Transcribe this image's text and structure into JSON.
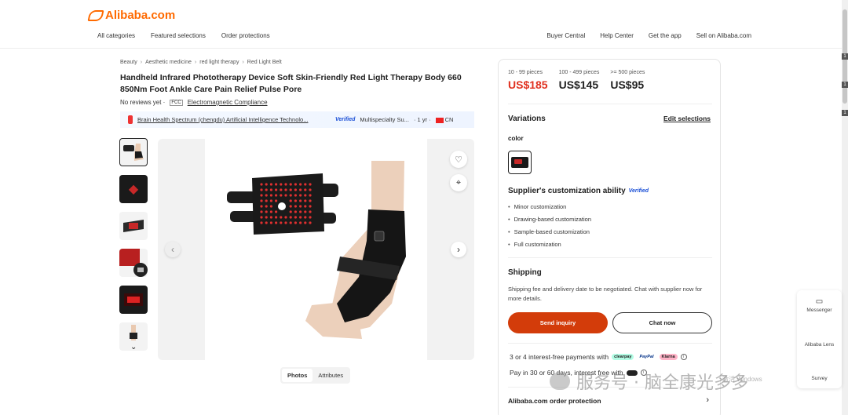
{
  "header": {
    "logo_text": "Alibaba.com",
    "nav_left": [
      "All categories",
      "Featured selections",
      "Order protections"
    ],
    "nav_right": [
      "Buyer Central",
      "Help Center",
      "Get the app",
      "Sell on Alibaba.com"
    ]
  },
  "breadcrumb": [
    "Beauty",
    "Aesthetic medicine",
    "red light therapy",
    "Red Light Belt"
  ],
  "product": {
    "title": "Handheld Infrared Phototherapy Device Soft Skin-Friendly Red Light Therapy Body 660 850Nm Foot Ankle Care Pain Relief Pulse Pore",
    "reviews": "No reviews yet ·",
    "fcc": "FCC",
    "certification": "Electromagnetic Compliance"
  },
  "supplier": {
    "name": "Brain Health Spectrum (chengdu) Artificial Intelligence Technolo...",
    "verified": "Verified",
    "type": "Multispecialty Su...",
    "years": "· 1 yr ·",
    "country": "CN"
  },
  "gallery": {
    "tabs": [
      "Photos",
      "Attributes"
    ],
    "active_tab": "Photos"
  },
  "pricing": {
    "tiers": [
      {
        "qty": "10 - 99 pieces",
        "price": "US$185"
      },
      {
        "qty": "100 - 499 pieces",
        "price": "US$145"
      },
      {
        "qty": ">= 500 pieces",
        "price": "US$95"
      }
    ]
  },
  "variations": {
    "title": "Variations",
    "edit_label": "Edit selections",
    "color_label": "color"
  },
  "customization": {
    "title": "Supplier's customization ability",
    "verified": "Verified",
    "items": [
      "Minor customization",
      "Drawing-based customization",
      "Sample-based customization",
      "Full customization"
    ]
  },
  "shipping": {
    "title": "Shipping",
    "text": "Shipping fee and delivery date to be negotiated. Chat with supplier now for more details.",
    "send_inquiry": "Send inquiry",
    "chat_now": "Chat now"
  },
  "payments": {
    "line1": "3 or 4 interest-free payments with",
    "line1_logos": [
      "clearpay",
      "PayPal",
      "Klarna"
    ],
    "line2": "Pay in 30 or 60 days, interest free with"
  },
  "protection": {
    "title": "Alibaba.com order protection"
  },
  "rail": {
    "items": [
      "Messenger",
      "Alibaba Lens",
      "Survey"
    ]
  },
  "overlay": {
    "watermark": "服务号 · 脑全康光多多",
    "activate": "激活 Windows"
  },
  "colors": {
    "brand": "#ff6a00",
    "price_red": "#e0301e",
    "inquiry": "#d33c0a",
    "verified": "#1a4fd6"
  }
}
